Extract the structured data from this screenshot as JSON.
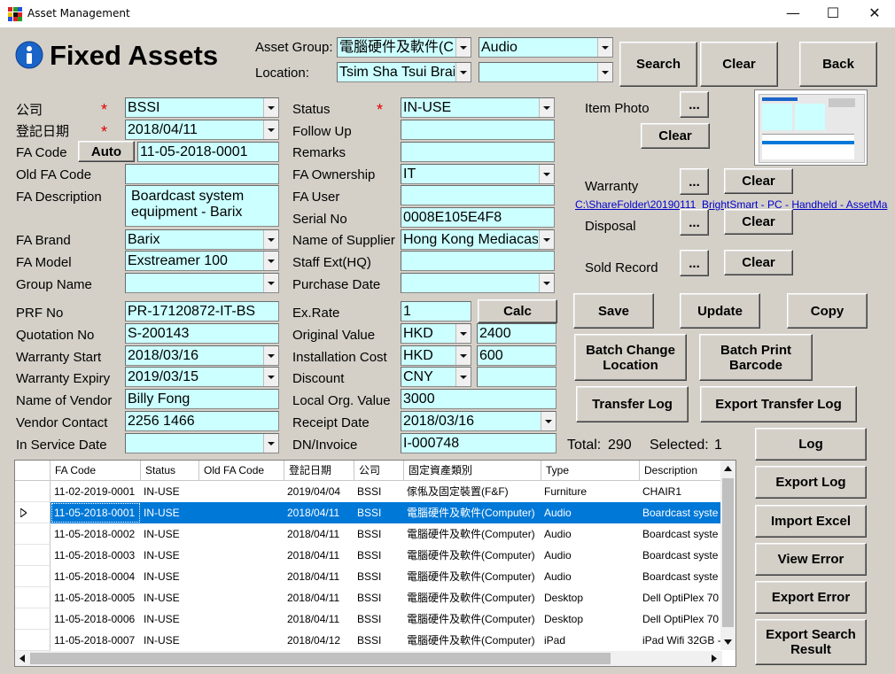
{
  "window": {
    "title": "Asset Management",
    "minimize": "—",
    "maximize": "☐",
    "close": "✕"
  },
  "header": {
    "title": "Fixed Assets",
    "asset_group_label": "Asset Group:",
    "asset_group_value": "電腦硬件及軟件(C",
    "asset_type_value": "Audio",
    "location_label": "Location:",
    "location_value": "Tsim Sha Tsui Brai",
    "location_sub_value": "",
    "search": "Search",
    "clear": "Clear",
    "back": "Back"
  },
  "left": {
    "company_label": "公司",
    "company": "BSSI",
    "reg_date_label": "登記日期",
    "reg_date": "2018/04/11",
    "fa_code_label": "FA Code",
    "auto_button": "Auto",
    "fa_code": "11-05-2018-0001",
    "old_fa_code_label": "Old FA Code",
    "old_fa_code": "",
    "fa_description_label": "FA Description",
    "fa_description": "Boardcast system equipment - Barix",
    "fa_brand_label": "FA Brand",
    "fa_brand": "Barix",
    "fa_model_label": "FA Model",
    "fa_model": "Exstreamer 100",
    "group_name_label": "Group Name",
    "group_name": "",
    "prf_no_label": "PRF No",
    "prf_no": "PR-17120872-IT-BS",
    "quotation_no_label": "Quotation No",
    "quotation_no": "S-200143",
    "warranty_start_label": "Warranty Start",
    "warranty_start": "2018/03/16",
    "warranty_expiry_label": "Warranty Expiry",
    "warranty_expiry": "2019/03/15",
    "vendor_name_label": "Name of Vendor",
    "vendor_name": "Billy Fong",
    "vendor_contact_label": "Vendor Contact",
    "vendor_contact": "2256 1466",
    "in_service_date_label": "In Service Date",
    "in_service_date": "",
    "required_mark": "*"
  },
  "middle": {
    "status_label": "Status",
    "status": "IN-USE",
    "follow_up_label": "Follow Up",
    "follow_up": "",
    "remarks_label": "Remarks",
    "remarks": "",
    "fa_ownership_label": "FA Ownership",
    "fa_ownership": "IT",
    "fa_user_label": "FA User",
    "fa_user": "",
    "serial_no_label": "Serial No",
    "serial_no": "0008E105E4F8",
    "supplier_label": "Name of Supplier",
    "supplier": "Hong Kong Mediacast",
    "staff_ext_label": "Staff Ext(HQ)",
    "staff_ext": "",
    "purchase_date_label": "Purchase Date",
    "purchase_date": "",
    "ex_rate_label": "Ex.Rate",
    "ex_rate": "1",
    "calc_button": "Calc",
    "original_value_label": "Original Value",
    "original_value_currency": "HKD",
    "original_value": "2400",
    "installation_cost_label": "Installation Cost",
    "installation_cost_currency": "HKD",
    "installation_cost": "600",
    "discount_label": "Discount",
    "discount_currency": "CNY",
    "discount": "",
    "local_org_value_label": "Local Org. Value",
    "local_org_value": "3000",
    "receipt_date_label": "Receipt Date",
    "receipt_date": "2018/03/16",
    "dn_invoice_label": "DN/Invoice",
    "dn_invoice": "I-000748"
  },
  "right": {
    "item_photo_label": "Item Photo",
    "browse": "...",
    "clear": "Clear",
    "warranty_label": "Warranty",
    "warranty_link": "C:\\ShareFolder\\20190111_BrightSmart - PC - Handheld - AssetMa",
    "disposal_label": "Disposal",
    "sold_record_label": "Sold Record",
    "save": "Save",
    "update": "Update",
    "copy": "Copy",
    "batch_change_location": "Batch Change Location",
    "batch_print_barcode": "Batch Print Barcode",
    "transfer_log": "Transfer Log",
    "export_transfer_log": "Export Transfer Log",
    "total_label": "Total:",
    "total": "290",
    "selected_label": "Selected:",
    "selected": "1",
    "log": "Log",
    "export_log": "Export Log",
    "import_excel": "Import Excel",
    "view_error": "View Error",
    "export_error": "Export Error",
    "export_search_result": "Export Search Result"
  },
  "table": {
    "columns": [
      "FA Code",
      "Status",
      "Old FA Code",
      "登記日期",
      "公司",
      "固定資產類別",
      "Type",
      "Description"
    ],
    "rows": [
      [
        "11-02-2019-0001",
        "IN-USE",
        "",
        "2019/04/04",
        "BSSI",
        "傢俬及固定裝置(F&F)",
        "Furniture",
        "CHAIR1"
      ],
      [
        "11-05-2018-0001",
        "IN-USE",
        "",
        "2018/04/11",
        "BSSI",
        "電腦硬件及軟件(Computer)",
        "Audio",
        "Boardcast syste"
      ],
      [
        "11-05-2018-0002",
        "IN-USE",
        "",
        "2018/04/11",
        "BSSI",
        "電腦硬件及軟件(Computer)",
        "Audio",
        "Boardcast syste"
      ],
      [
        "11-05-2018-0003",
        "IN-USE",
        "",
        "2018/04/11",
        "BSSI",
        "電腦硬件及軟件(Computer)",
        "Audio",
        "Boardcast syste"
      ],
      [
        "11-05-2018-0004",
        "IN-USE",
        "",
        "2018/04/11",
        "BSSI",
        "電腦硬件及軟件(Computer)",
        "Audio",
        "Boardcast syste"
      ],
      [
        "11-05-2018-0005",
        "IN-USE",
        "",
        "2018/04/11",
        "BSSI",
        "電腦硬件及軟件(Computer)",
        "Desktop",
        "Dell OptiPlex 70"
      ],
      [
        "11-05-2018-0006",
        "IN-USE",
        "",
        "2018/04/11",
        "BSSI",
        "電腦硬件及軟件(Computer)",
        "Desktop",
        "Dell OptiPlex 70"
      ],
      [
        "11-05-2018-0007",
        "IN-USE",
        "",
        "2018/04/12",
        "BSSI",
        "電腦硬件及軟件(Computer)",
        "iPad",
        "iPad Wifi 32GB -"
      ]
    ],
    "selected_row": 1
  },
  "colors": {
    "field_bg": "#ccffff",
    "selection": "#0078d7",
    "required": "#e00000",
    "form_bg": "#d4d0c8",
    "info_icon": "#1a64c8"
  }
}
